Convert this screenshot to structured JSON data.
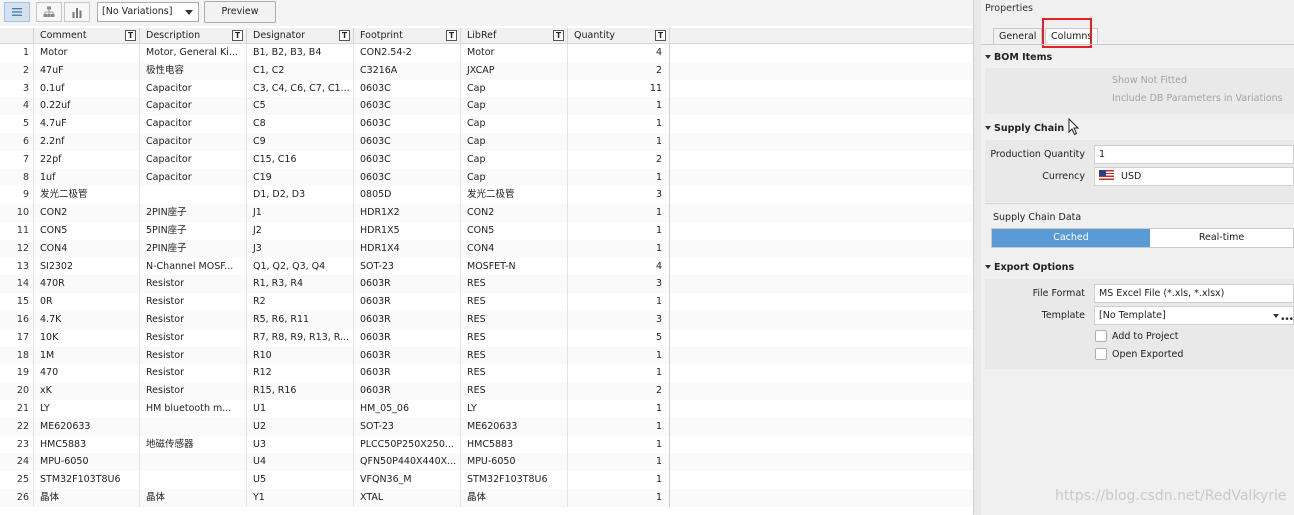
{
  "toolbar": {
    "variation_select": "[No Variations]",
    "preview_label": "Preview"
  },
  "bom": {
    "headers": [
      "Comment",
      "Description",
      "Designator",
      "Footprint",
      "LibRef",
      "Quantity"
    ],
    "filter_glyph": "T",
    "rows": [
      {
        "idx": "1",
        "comment": "Motor",
        "desc": "Motor, General Ki...",
        "desig": "B1, B2, B3, B4",
        "foot": "CON2.54-2",
        "lib": "Motor",
        "qty": "4"
      },
      {
        "idx": "2",
        "comment": "47uF",
        "desc": "极性电容",
        "desig": "C1, C2",
        "foot": "C3216A",
        "lib": "JXCAP",
        "qty": "2"
      },
      {
        "idx": "3",
        "comment": "0.1uf",
        "desc": "Capacitor",
        "desig": "C3, C4, C6, C7, C1...",
        "foot": "0603C",
        "lib": "Cap",
        "qty": "11"
      },
      {
        "idx": "4",
        "comment": "0.22uf",
        "desc": "Capacitor",
        "desig": "C5",
        "foot": "0603C",
        "lib": "Cap",
        "qty": "1"
      },
      {
        "idx": "5",
        "comment": "4.7uF",
        "desc": "Capacitor",
        "desig": "C8",
        "foot": "0603C",
        "lib": "Cap",
        "qty": "1"
      },
      {
        "idx": "6",
        "comment": "2.2nf",
        "desc": "Capacitor",
        "desig": "C9",
        "foot": "0603C",
        "lib": "Cap",
        "qty": "1"
      },
      {
        "idx": "7",
        "comment": "22pf",
        "desc": "Capacitor",
        "desig": "C15, C16",
        "foot": "0603C",
        "lib": "Cap",
        "qty": "2"
      },
      {
        "idx": "8",
        "comment": "1uf",
        "desc": "Capacitor",
        "desig": "C19",
        "foot": "0603C",
        "lib": "Cap",
        "qty": "1"
      },
      {
        "idx": "9",
        "comment": "发光二极管",
        "desc": "",
        "desig": "D1, D2, D3",
        "foot": "0805D",
        "lib": "发光二极管",
        "qty": "3"
      },
      {
        "idx": "10",
        "comment": "CON2",
        "desc": "2PIN座子",
        "desig": "J1",
        "foot": "HDR1X2",
        "lib": "CON2",
        "qty": "1"
      },
      {
        "idx": "11",
        "comment": "CON5",
        "desc": "5PIN座子",
        "desig": "J2",
        "foot": "HDR1X5",
        "lib": "CON5",
        "qty": "1"
      },
      {
        "idx": "12",
        "comment": "CON4",
        "desc": "2PIN座子",
        "desig": "J3",
        "foot": "HDR1X4",
        "lib": "CON4",
        "qty": "1"
      },
      {
        "idx": "13",
        "comment": "SI2302",
        "desc": "N-Channel MOSF...",
        "desig": "Q1, Q2, Q3, Q4",
        "foot": "SOT-23",
        "lib": "MOSFET-N",
        "qty": "4"
      },
      {
        "idx": "14",
        "comment": "470R",
        "desc": "Resistor",
        "desig": "R1, R3, R4",
        "foot": "0603R",
        "lib": "RES",
        "qty": "3"
      },
      {
        "idx": "15",
        "comment": "0R",
        "desc": "Resistor",
        "desig": "R2",
        "foot": "0603R",
        "lib": "RES",
        "qty": "1"
      },
      {
        "idx": "16",
        "comment": "4.7K",
        "desc": "Resistor",
        "desig": "R5, R6, R11",
        "foot": "0603R",
        "lib": "RES",
        "qty": "3"
      },
      {
        "idx": "17",
        "comment": "10K",
        "desc": "Resistor",
        "desig": "R7, R8, R9, R13, R...",
        "foot": "0603R",
        "lib": "RES",
        "qty": "5"
      },
      {
        "idx": "18",
        "comment": "1M",
        "desc": "Resistor",
        "desig": "R10",
        "foot": "0603R",
        "lib": "RES",
        "qty": "1"
      },
      {
        "idx": "19",
        "comment": "470",
        "desc": "Resistor",
        "desig": "R12",
        "foot": "0603R",
        "lib": "RES",
        "qty": "1"
      },
      {
        "idx": "20",
        "comment": "xK",
        "desc": "Resistor",
        "desig": "R15, R16",
        "foot": "0603R",
        "lib": "RES",
        "qty": "2"
      },
      {
        "idx": "21",
        "comment": "LY",
        "desc": "HM bluetooth m...",
        "desig": "U1",
        "foot": "HM_05_06",
        "lib": "LY",
        "qty": "1"
      },
      {
        "idx": "22",
        "comment": "ME620633",
        "desc": "",
        "desig": "U2",
        "foot": "SOT-23",
        "lib": "ME620633",
        "qty": "1"
      },
      {
        "idx": "23",
        "comment": "HMC5883",
        "desc": "地磁传感器",
        "desig": "U3",
        "foot": "PLCC50P250X250...",
        "lib": "HMC5883",
        "qty": "1"
      },
      {
        "idx": "24",
        "comment": "MPU-6050",
        "desc": "",
        "desig": "U4",
        "foot": "QFN50P440X440X...",
        "lib": "MPU-6050",
        "qty": "1"
      },
      {
        "idx": "25",
        "comment": "STM32F103T8U6",
        "desc": "",
        "desig": "U5",
        "foot": "VFQN36_M",
        "lib": "STM32F103T8U6",
        "qty": "1"
      },
      {
        "idx": "26",
        "comment": "晶体",
        "desc": "晶体",
        "desig": "Y1",
        "foot": "XTAL",
        "lib": "晶体",
        "qty": "1"
      }
    ]
  },
  "panel": {
    "title": "Properties",
    "tabs": [
      "General",
      "Columns"
    ],
    "bom_items": {
      "title": "BOM Items",
      "show_not_fitted": "Show Not Fitted",
      "include_db": "Include DB Parameters in Variations"
    },
    "supply_chain": {
      "title": "Supply Chain",
      "production_quantity_label": "Production Quantity",
      "production_quantity_value": "1",
      "currency_label": "Currency",
      "currency_value": "USD",
      "data_label": "Supply Chain Data",
      "cached": "Cached",
      "realtime": "Real-time"
    },
    "export": {
      "title": "Export Options",
      "file_format_label": "File Format",
      "file_format_value": "MS Excel File (*.xls, *.xlsx)",
      "template_label": "Template",
      "template_value": "[No Template]",
      "add_to_project": "Add to Project",
      "open_exported": "Open Exported"
    }
  },
  "watermark": "https://blog.csdn.net/RedValkyrie",
  "colors": {
    "accent": "#5b9bd5",
    "highlight": "#e52020"
  }
}
